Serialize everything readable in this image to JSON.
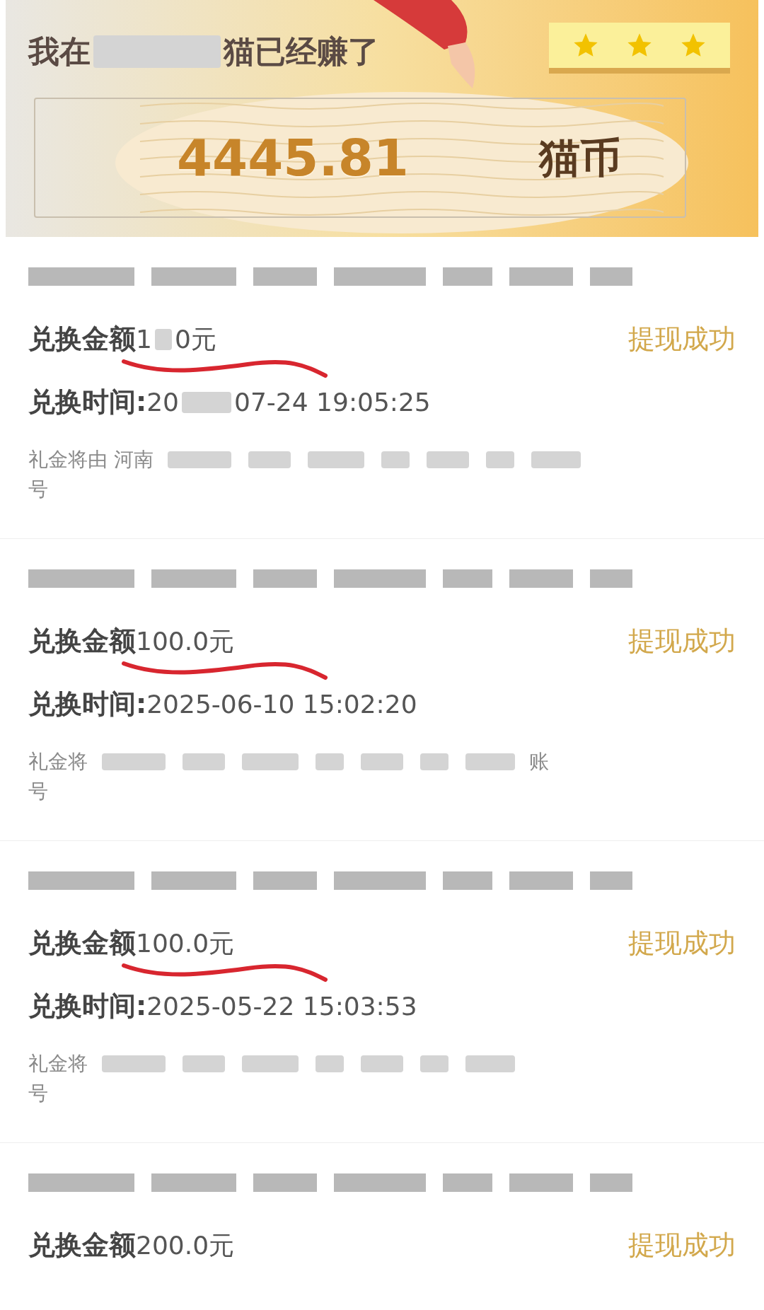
{
  "header": {
    "title": [
      "我在",
      "猫已经赚了"
    ],
    "stars": 3,
    "balance": "4445.81",
    "unit": "猫币"
  },
  "records": [
    {
      "amount_label": "兑换金额",
      "amount": [
        "1",
        "0元"
      ],
      "time_label": "兑换时间:",
      "time": [
        "20",
        "07-24 19:05:25"
      ],
      "status": "提现成功",
      "note": [
        "礼金将由 河南"
      ],
      "note_line2": "号",
      "underlined": true
    },
    {
      "amount_label": "兑换金额",
      "amount": [
        "100.0元"
      ],
      "time_label": "兑换时间:",
      "time": [
        "2025-06-10 15:02:20"
      ],
      "status": "提现成功",
      "note": [
        "礼金将"
      ],
      "note_tail": "账",
      "note_line2": "号",
      "underlined": true
    },
    {
      "amount_label": "兑换金额",
      "amount": [
        "100.0元"
      ],
      "time_label": "兑换时间:",
      "time": [
        "2025-05-22 15:03:53"
      ],
      "status": "提现成功",
      "note": [
        "礼金将"
      ],
      "note_line2": "号",
      "underlined": true
    },
    {
      "amount_label": "兑换金额",
      "amount": [
        "200.0元"
      ],
      "status": "提现成功",
      "underlined": false
    }
  ]
}
